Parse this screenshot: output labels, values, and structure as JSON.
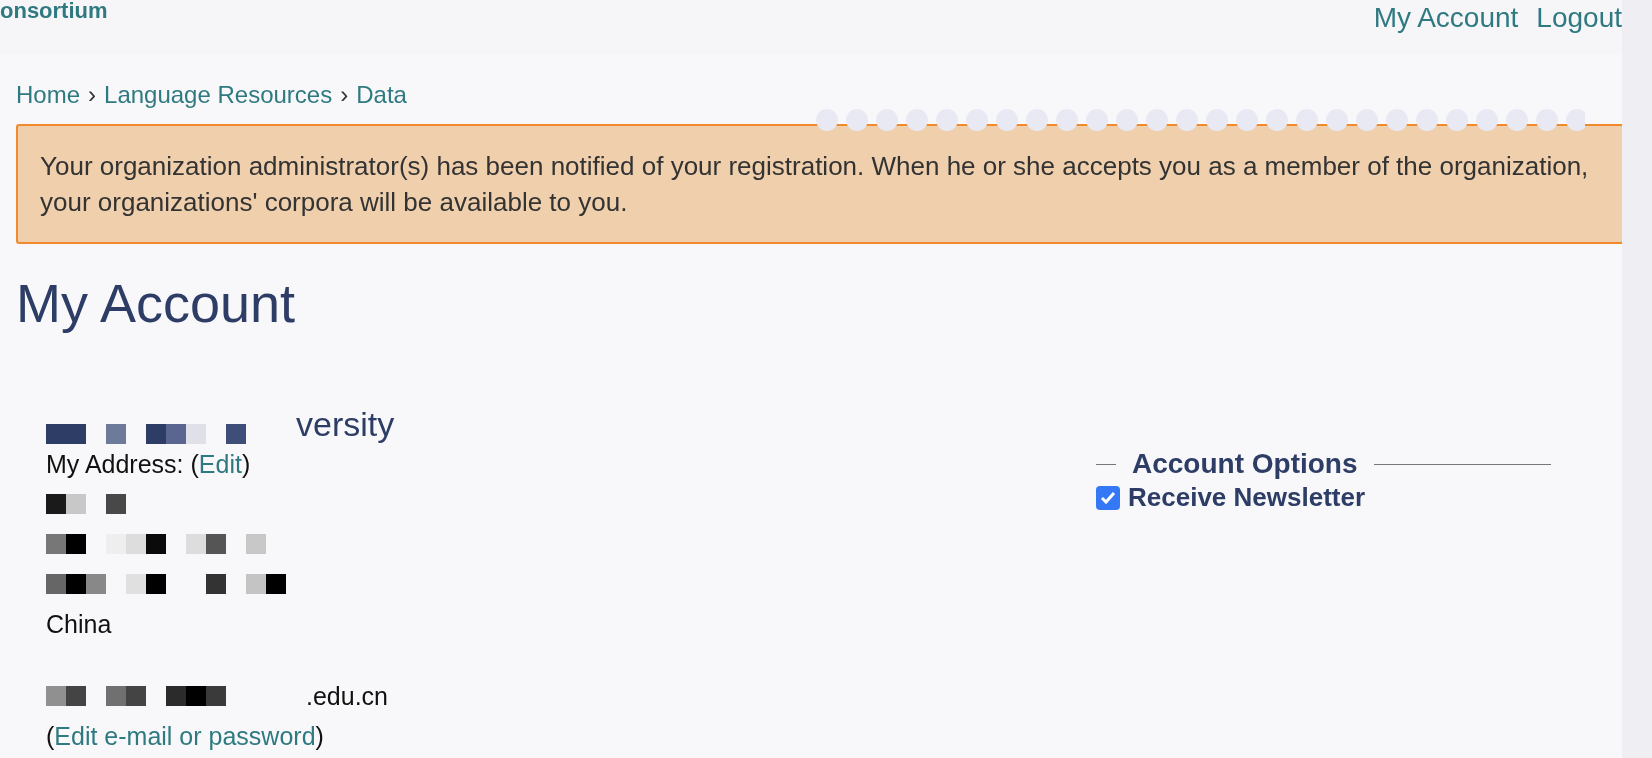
{
  "header": {
    "logo_text": "onsortium",
    "nav": [
      {
        "label": "My Account"
      },
      {
        "label": "Logout"
      }
    ]
  },
  "breadcrumb": {
    "separator": "›",
    "items": [
      "Home",
      "Language Resources",
      "Data"
    ]
  },
  "notice": "Your organization administrator(s) has been notified of your registration. When he or she accepts you as a member of the organization, your organizations' corpora will be available to you.",
  "title": "My Account",
  "organization": "versity",
  "address": {
    "label": "My Address:",
    "open": "(",
    "edit_link": "Edit",
    "close": ")",
    "country": "China"
  },
  "email": {
    "suffix": ".edu.cn",
    "open": "(",
    "edit_link": "Edit e-mail or password",
    "close": ")"
  },
  "account_options": {
    "legend": "Account Options",
    "options": [
      {
        "label": "Receive Newsletter",
        "checked": true
      }
    ]
  }
}
